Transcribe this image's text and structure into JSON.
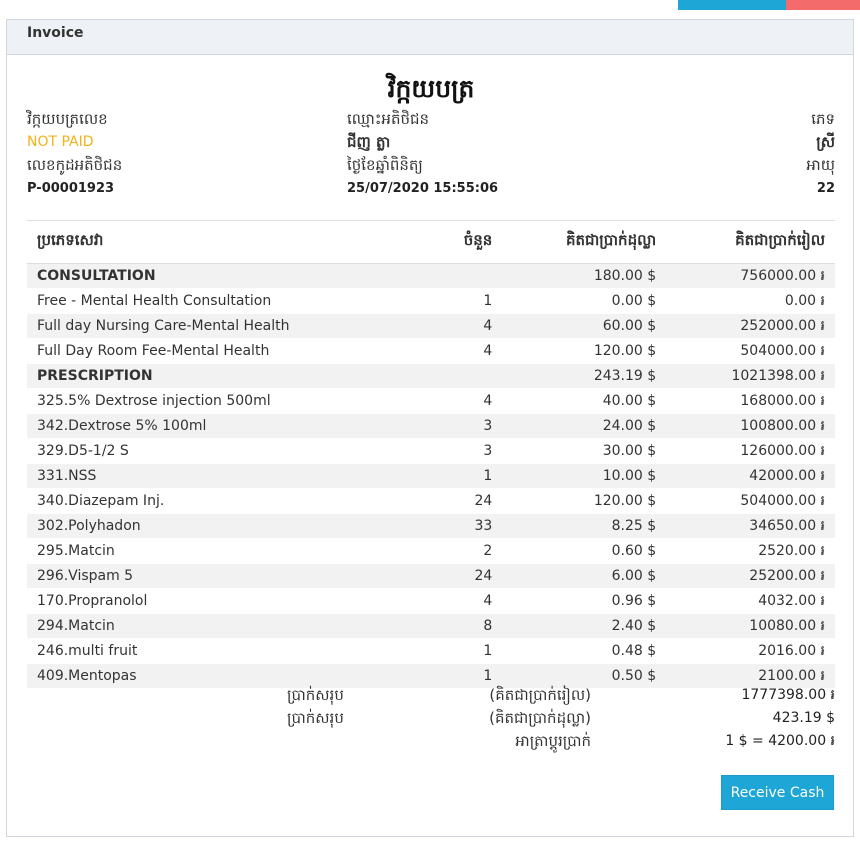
{
  "panel": {
    "title": "Invoice"
  },
  "document": {
    "title": "វិក្កយបត្រ"
  },
  "info": {
    "invoice_label": "វិក្កយបត្រលេខ",
    "payment_status": "NOT PAID",
    "patient_code_label": "លេខកូដអតិថិជន",
    "patient_code": "P-00001923",
    "customer_name_label": "ឈ្មោះអតិថិជន",
    "customer_name": "ជីញ ត្លា",
    "date_label": "ថ្ងៃខែឆ្នាំពិនិត្យ",
    "date": "25/07/2020 15:55:06",
    "gender_label": "ភេទ",
    "gender": "ស្រី",
    "age_label": "អាយុ",
    "age": "22"
  },
  "table": {
    "headers": [
      "ប្រភេទសេវា",
      "ចំនួន",
      "គិតជាប្រាក់ដុល្លា",
      "គិតជាប្រាក់រៀល"
    ],
    "rows": [
      {
        "name": "CONSULTATION",
        "qty": "",
        "usd": "180.00 $",
        "khr": "756000.00 ៛"
      },
      {
        "name": "Free - Mental Health Consultation",
        "qty": "1",
        "usd": "0.00 $",
        "khr": "0.00 ៛"
      },
      {
        "name": "Full day Nursing Care-Mental Health",
        "qty": "4",
        "usd": "60.00 $",
        "khr": "252000.00 ៛"
      },
      {
        "name": "Full Day Room Fee-Mental Health",
        "qty": "4",
        "usd": "120.00 $",
        "khr": "504000.00 ៛"
      },
      {
        "name": "PRESCRIPTION",
        "qty": "",
        "usd": "243.19 $",
        "khr": "1021398.00 ៛"
      },
      {
        "name": "325.5% Dextrose injection 500ml",
        "qty": "4",
        "usd": "40.00 $",
        "khr": "168000.00 ៛"
      },
      {
        "name": "342.Dextrose 5% 100ml",
        "qty": "3",
        "usd": "24.00 $",
        "khr": "100800.00 ៛"
      },
      {
        "name": "329.D5-1/2 S",
        "qty": "3",
        "usd": "30.00 $",
        "khr": "126000.00 ៛"
      },
      {
        "name": "331.NSS",
        "qty": "1",
        "usd": "10.00 $",
        "khr": "42000.00 ៛"
      },
      {
        "name": "340.Diazepam Inj.",
        "qty": "24",
        "usd": "120.00 $",
        "khr": "504000.00 ៛"
      },
      {
        "name": "302.Polyhadon",
        "qty": "33",
        "usd": "8.25 $",
        "khr": "34650.00 ៛"
      },
      {
        "name": "295.Matcin",
        "qty": "2",
        "usd": "0.60 $",
        "khr": "2520.00 ៛"
      },
      {
        "name": "296.Vispam 5",
        "qty": "24",
        "usd": "6.00 $",
        "khr": "25200.00 ៛"
      },
      {
        "name": "170.Propranolol",
        "qty": "4",
        "usd": "0.96 $",
        "khr": "4032.00 ៛"
      },
      {
        "name": "294.Matcin",
        "qty": "8",
        "usd": "2.40 $",
        "khr": "10080.00 ៛"
      },
      {
        "name": "246.multi fruit",
        "qty": "1",
        "usd": "0.48 $",
        "khr": "2016.00 ៛"
      },
      {
        "name": "409.Mentopas",
        "qty": "1",
        "usd": "0.50 $",
        "khr": "2100.00 ៛"
      }
    ]
  },
  "summary": {
    "total_khr_label": "ប្រាក់សរុប",
    "total_khr_currency": "(គិតជាប្រាក់រៀល)",
    "total_khr": "1777398.00 ៛",
    "total_usd_label": "ប្រាក់សរុប",
    "total_usd_currency": "(គិតជាប្រាក់ដុល្លា)",
    "total_usd": "423.19 $",
    "exchange_rate_label": "អាត្រាប្តូរប្រាក់",
    "exchange_rate": "1 $ = 4200.00 ៛"
  },
  "actions": {
    "receive_cash": "Receive Cash"
  },
  "colors": {
    "accent": "#1ea7d6",
    "danger": "#f46b6b",
    "warning_text": "#f3b21a"
  }
}
